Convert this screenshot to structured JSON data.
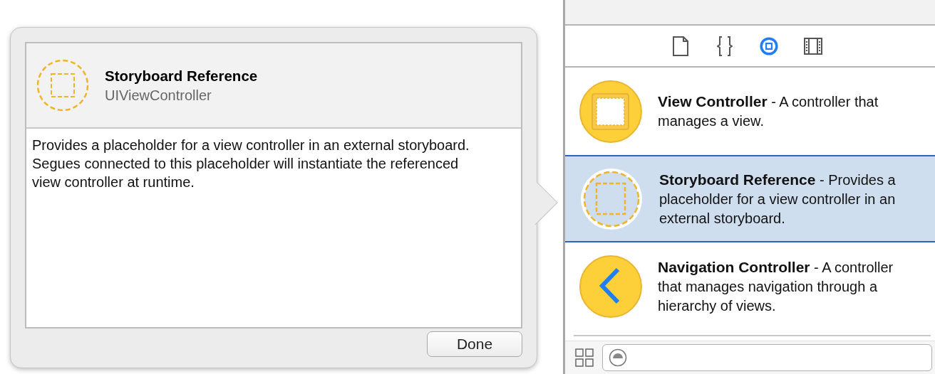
{
  "popover": {
    "title": "Storyboard Reference",
    "subtitle": "UIViewController",
    "description": "Provides a placeholder for a view controller in an external storyboard. Segues connected to this placeholder will instantiate the referenced view controller at runtime.",
    "done_button": "Done"
  },
  "inspector_tabs": [
    {
      "kind": "file",
      "selected": false
    },
    {
      "kind": "code",
      "selected": false
    },
    {
      "kind": "object",
      "selected": true
    },
    {
      "kind": "media",
      "selected": false
    }
  ],
  "library_items": [
    {
      "kind": "view-controller",
      "text": "**View Controller** - A controller that manages a view.",
      "selected": false
    },
    {
      "kind": "storyboard-reference",
      "text": "**Storyboard Reference** - Provides a placeholder for a view controller in an external storyboard.",
      "selected": true
    },
    {
      "kind": "navigation-controller",
      "text": "**Navigation Controller** - A controller that manages navigation through a hierarchy of views.",
      "selected": false
    }
  ]
}
